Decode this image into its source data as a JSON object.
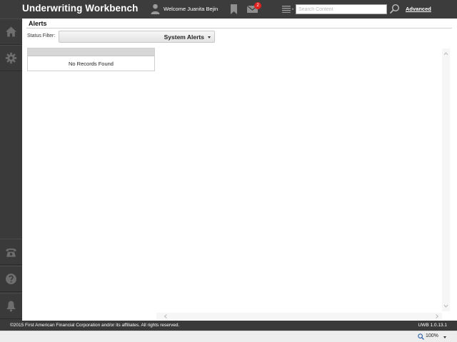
{
  "header": {
    "app_title": "Underwriting Workbench",
    "user_icon": "user-icon",
    "welcome_text": "Welcome Juanita Bejin",
    "bookmark_icon": "bookmark-icon",
    "mail_icon": "mail-icon",
    "mail_badge_count": "2",
    "list_icon": "list-icon",
    "search": {
      "placeholder": "Search Content",
      "value": ""
    },
    "search_icon": "search-icon",
    "advanced_label": "Advanced"
  },
  "sidebar": {
    "items": [
      {
        "icon": "home-icon"
      },
      {
        "icon": "gear-icon"
      },
      {
        "icon": "phone-icon"
      },
      {
        "icon": "help-icon"
      },
      {
        "icon": "bell-icon"
      }
    ]
  },
  "main": {
    "title": "Alerts",
    "status_filter_label": "Status Filter:",
    "status_filter_value": "System Alerts",
    "grid": {
      "empty_message": "No Records Found"
    }
  },
  "footer": {
    "copyright": "©2015 First American Financial Corporation and/or its affiliates. All rights reserved.",
    "version": "UWB 1.0.13.1"
  },
  "statusbar": {
    "zoom": "100%"
  },
  "colors": {
    "header_bg": "#3c3c3c",
    "sidebar_bg": "#3a3a3a",
    "badge": "#dd2222",
    "content_bg": "#ffffff"
  }
}
